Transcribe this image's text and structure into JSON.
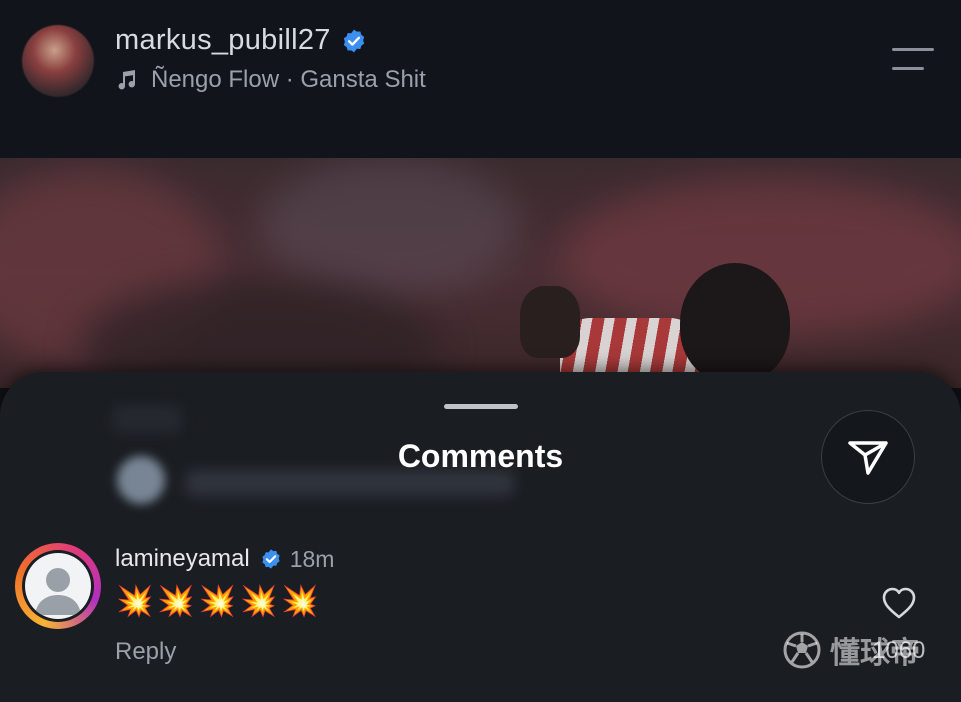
{
  "header": {
    "username": "markus_pubill27",
    "verified": true,
    "music": "Ñengo Flow · Gansta Shit",
    "icons": {
      "avatar": "profile-avatar",
      "verified": "verified-badge-icon",
      "music": "music-note-icon",
      "menu": "menu-icon"
    }
  },
  "comments_sheet": {
    "title": "Comments",
    "share_icon": "send-icon",
    "comment": {
      "username": "lamineyamal",
      "verified": true,
      "time": "18m",
      "text": "💥💥💥💥💥",
      "reply_label": "Reply",
      "like_count": "1060",
      "like_icon": "heart-icon"
    }
  },
  "watermark": {
    "text": "懂球帝",
    "icon": "soccer-ball-icon"
  },
  "colors": {
    "background": "#0e1116",
    "sheet": "#1a1d22",
    "verified_blue": "#3b8ff0",
    "muted_text": "#9aa1ab"
  }
}
